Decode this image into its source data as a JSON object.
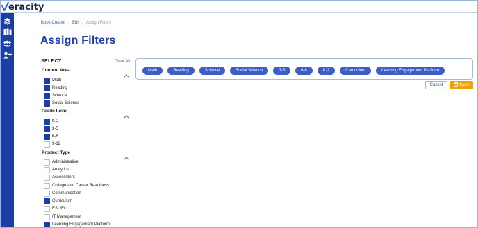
{
  "brand": {
    "name": "eracity"
  },
  "sidebar": {
    "items": [
      {
        "icon": "layers-icon"
      },
      {
        "icon": "books-icon"
      },
      {
        "icon": "group-icon"
      },
      {
        "icon": "add-user-icon"
      }
    ]
  },
  "breadcrumb": [
    "Book Creator",
    "Edit",
    "Assign Filters"
  ],
  "breadcrumb_sep": "/",
  "page_title": "Assign Filters",
  "filters": {
    "title": "SELECT",
    "clear_all": "Clear All",
    "groups": [
      {
        "title": "Content Area",
        "options": [
          {
            "label": "Math",
            "checked": true
          },
          {
            "label": "Reading",
            "checked": true
          },
          {
            "label": "Science",
            "checked": true
          },
          {
            "label": "Social Science",
            "checked": true
          }
        ]
      },
      {
        "title": "Grade Level",
        "options": [
          {
            "label": "K-2",
            "checked": true
          },
          {
            "label": "3-5",
            "checked": true
          },
          {
            "label": "6-8",
            "checked": true
          },
          {
            "label": "9-12",
            "checked": false
          }
        ]
      },
      {
        "title": "Product Type",
        "options": [
          {
            "label": "Administrative",
            "checked": false
          },
          {
            "label": "Analytics",
            "checked": false
          },
          {
            "label": "Assessment",
            "checked": false
          },
          {
            "label": "College and Career Readiness",
            "checked": false
          },
          {
            "label": "Communication",
            "checked": false
          },
          {
            "label": "Curriculum",
            "checked": true
          },
          {
            "label": "ESL/ELL",
            "checked": false
          },
          {
            "label": "IT Management",
            "checked": false
          },
          {
            "label": "Learning Engagement Platform",
            "checked": true
          }
        ]
      }
    ]
  },
  "selected_chips": [
    "Math",
    "Reading",
    "Science",
    "Social Science",
    "3-5",
    "6-8",
    "K-2",
    "Curriculum",
    "Learning Engagement Platform"
  ],
  "actions": {
    "cancel": "Cancel",
    "save": "Save"
  },
  "colors": {
    "primary": "#1b3fa0",
    "chip": "#3b5fc6",
    "save": "#f4a000",
    "title": "#1e3fa8"
  }
}
